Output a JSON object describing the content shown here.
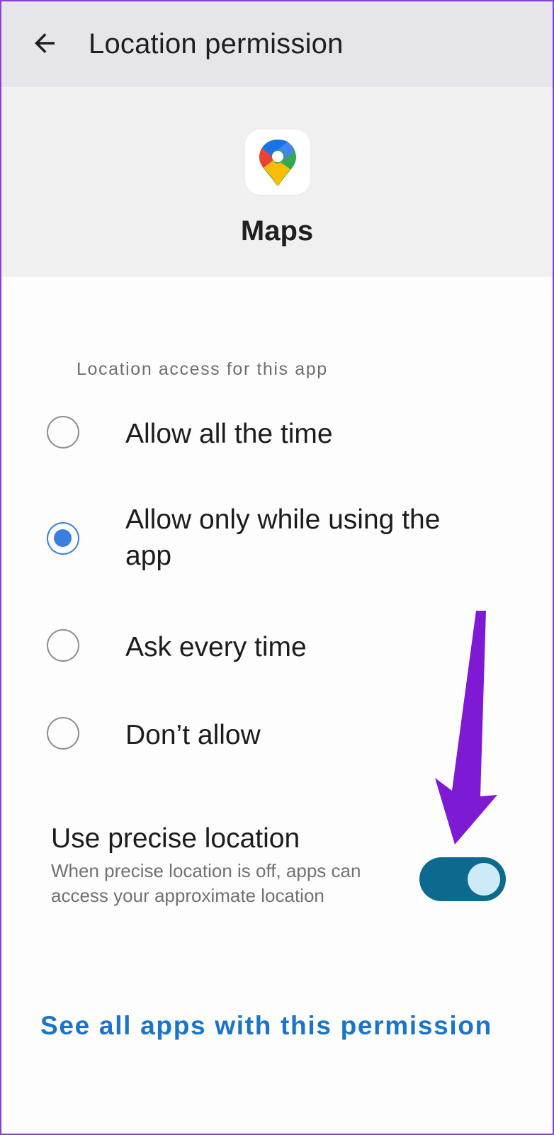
{
  "appbar": {
    "title": "Location permission"
  },
  "app": {
    "name": "Maps",
    "icon": "google-maps-icon"
  },
  "section_label": "Location access for this app",
  "options": [
    {
      "label": "Allow all the time",
      "selected": false
    },
    {
      "label": "Allow only while using the app",
      "selected": true
    },
    {
      "label": "Ask every time",
      "selected": false
    },
    {
      "label": "Don’t allow",
      "selected": false
    }
  ],
  "precise_location": {
    "title": "Use precise location",
    "description": "When precise location is off, apps can access your approximate location",
    "enabled": true
  },
  "see_all_link": "See all apps with this permission",
  "colors": {
    "accent": "#3a7fe0",
    "toggle_track": "#0b6a8d",
    "link": "#1a74c9",
    "annotation_arrow": "#7e19d4"
  }
}
